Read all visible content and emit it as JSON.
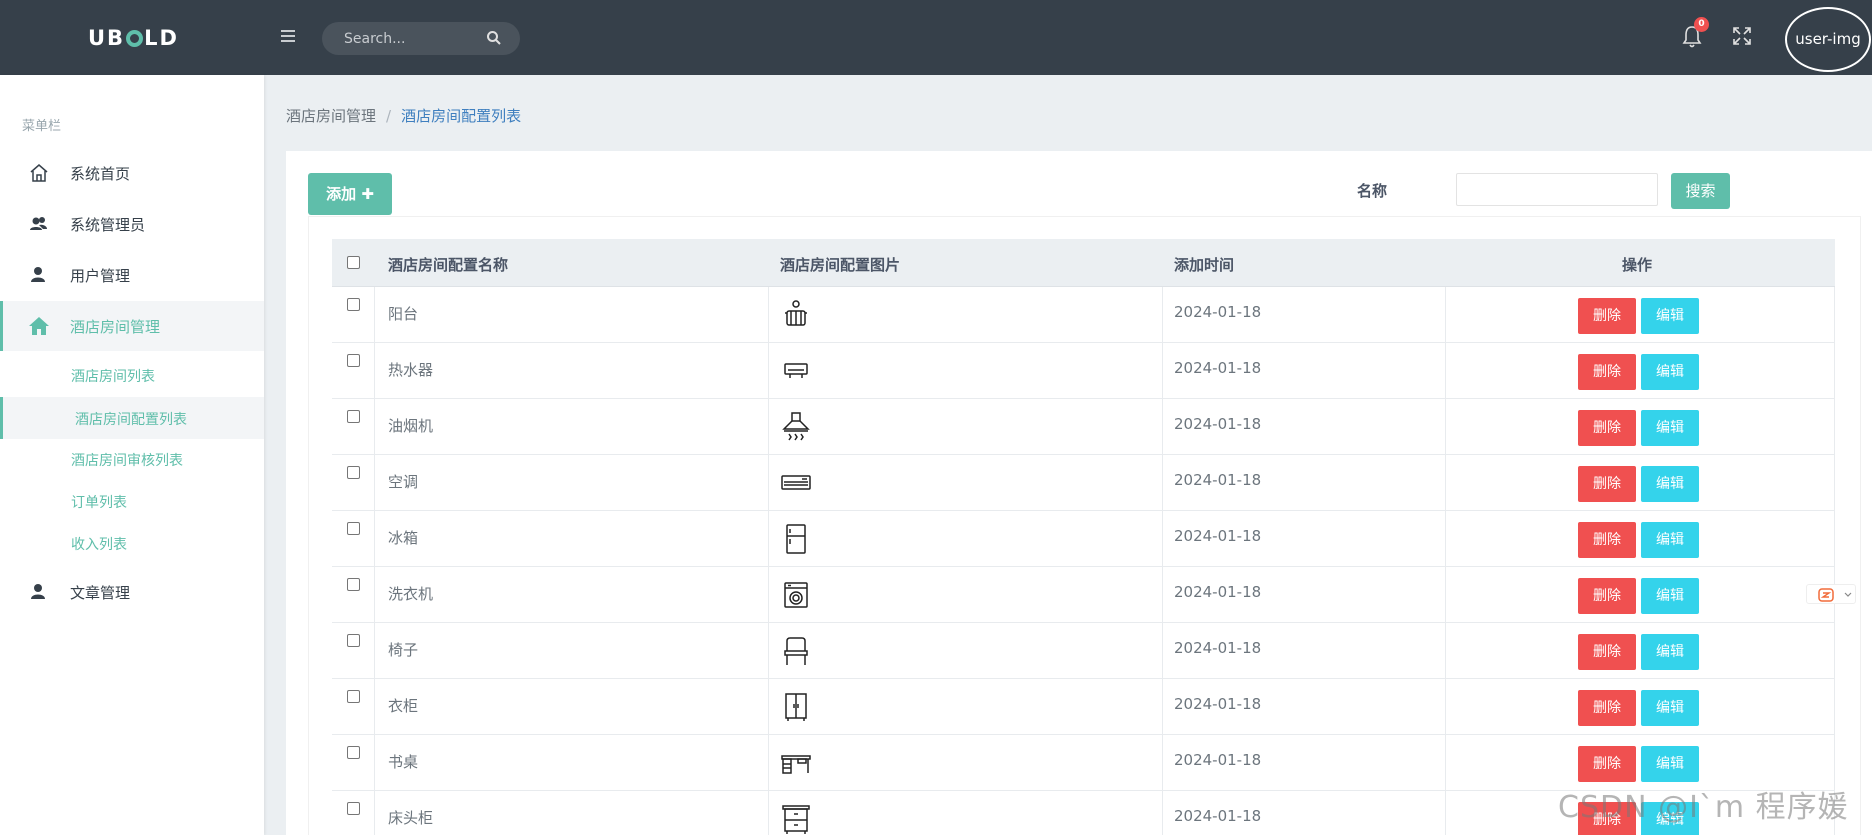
{
  "topbar": {
    "logo_pre": "UB",
    "logo_post": "LD",
    "search_placeholder": "Search...",
    "notification_count": "0",
    "avatar_text": "user-img"
  },
  "sidebar": {
    "title": "菜单栏",
    "items": [
      {
        "label": "系统首页",
        "icon": "home-outline-icon"
      },
      {
        "label": "系统管理员",
        "icon": "users-icon"
      },
      {
        "label": "用户管理",
        "icon": "user-icon"
      },
      {
        "label": "酒店房间管理",
        "icon": "home-icon"
      },
      {
        "label": "文章管理",
        "icon": "user-icon"
      }
    ],
    "subitems": [
      {
        "label": "酒店房间列表"
      },
      {
        "label": "酒店房间配置列表"
      },
      {
        "label": "酒店房间审核列表"
      },
      {
        "label": "订单列表"
      },
      {
        "label": "收入列表"
      }
    ]
  },
  "breadcrumb": {
    "parent": "酒店房间管理",
    "separator": "/",
    "current": "酒店房间配置列表"
  },
  "toolbar": {
    "add_label": "添加",
    "add_icon": "plus-icon",
    "name_label": "名称",
    "name_value": "",
    "search_label": "搜索"
  },
  "table": {
    "headers": [
      "酒店房间配置名称",
      "酒店房间配置图片",
      "添加时间",
      "操作"
    ],
    "delete_label": "删除",
    "edit_label": "编辑",
    "rows": [
      {
        "name": "阳台",
        "icon": "balcony-icon",
        "time": "2024-01-18"
      },
      {
        "name": "热水器",
        "icon": "water-heater-icon",
        "time": "2024-01-18"
      },
      {
        "name": "油烟机",
        "icon": "range-hood-icon",
        "time": "2024-01-18"
      },
      {
        "name": "空调",
        "icon": "air-conditioner-icon",
        "time": "2024-01-18"
      },
      {
        "name": "冰箱",
        "icon": "fridge-icon",
        "time": "2024-01-18"
      },
      {
        "name": "洗衣机",
        "icon": "washing-machine-icon",
        "time": "2024-01-18"
      },
      {
        "name": "椅子",
        "icon": "chair-icon",
        "time": "2024-01-18"
      },
      {
        "name": "衣柜",
        "icon": "wardrobe-icon",
        "time": "2024-01-18"
      },
      {
        "name": "书桌",
        "icon": "desk-icon",
        "time": "2024-01-18"
      },
      {
        "name": "床头柜",
        "icon": "nightstand-icon",
        "time": "2024-01-18"
      }
    ]
  },
  "watermark": "CSDN @I`m 程序媛",
  "colors": {
    "topbar": "#36404a",
    "accent": "#5fbeaa",
    "danger": "#f05050",
    "info": "#34d3eb",
    "link": "#3f7fbf"
  }
}
